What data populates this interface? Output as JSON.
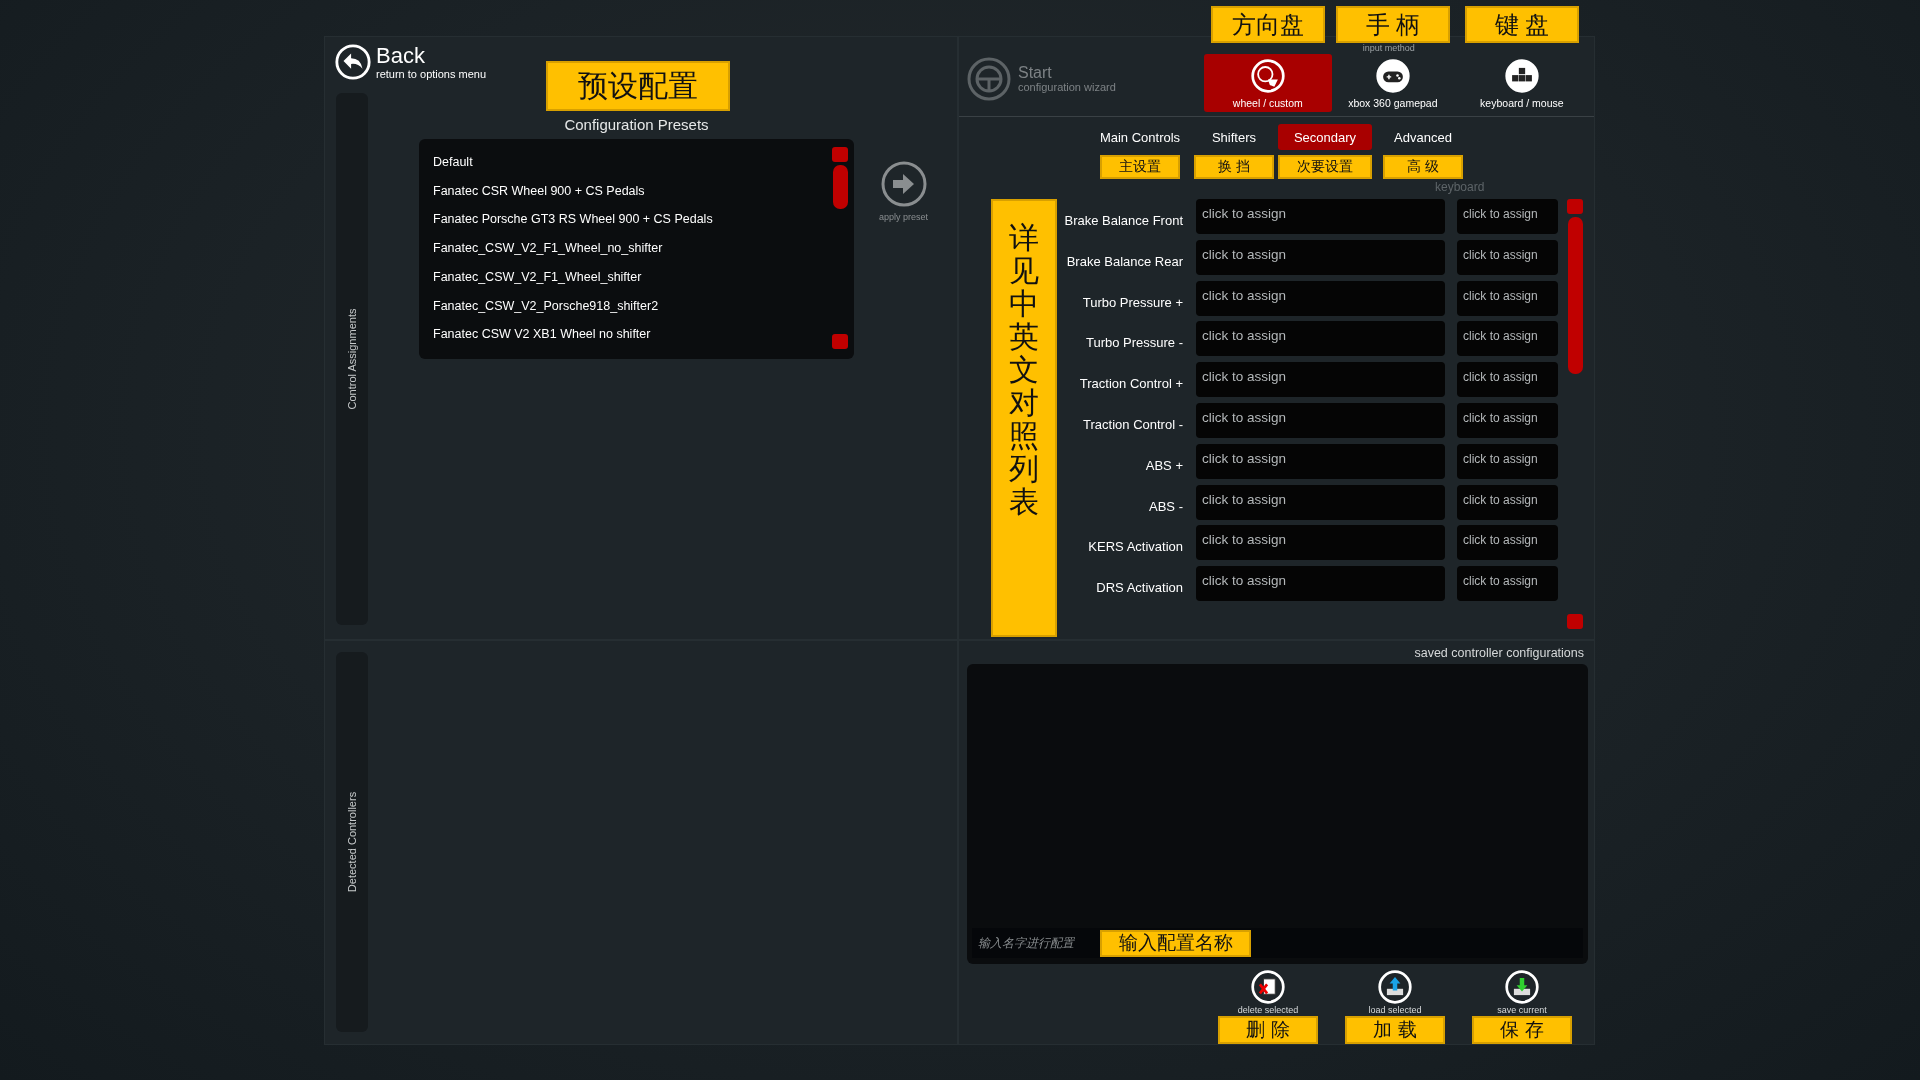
{
  "back": {
    "title": "Back",
    "subtitle": "return to options menu"
  },
  "sidebar_tabs": [
    {
      "label": "Control Assignments"
    },
    {
      "label": "Detected Controllers"
    }
  ],
  "presets": {
    "note": "预设配置",
    "title": "Configuration Presets",
    "apply_label": "apply preset",
    "items": [
      {
        "label": "Default"
      },
      {
        "label": "Fanatec CSR Wheel 900 + CS Pedals"
      },
      {
        "label": "Fanatec Porsche GT3 RS Wheel 900 + CS Pedals"
      },
      {
        "label": "Fanatec_CSW_V2_F1_Wheel_no_shifter"
      },
      {
        "label": "Fanatec_CSW_V2_F1_Wheel_shifter"
      },
      {
        "label": "Fanatec_CSW_V2_Porsche918_shifter2"
      },
      {
        "label": "Fanatec CSW V2 XB1 Wheel no shifter"
      }
    ]
  },
  "wizard": {
    "title": "Start",
    "subtitle": "configuration wizard"
  },
  "input_method": {
    "label": "input method",
    "options": [
      {
        "kind": "wheel",
        "label": "wheel / custom",
        "note": "方向盘",
        "selected": true
      },
      {
        "kind": "gamepad",
        "label": "xbox 360 gamepad",
        "note": "手 柄",
        "selected": false
      },
      {
        "kind": "keyboard",
        "label": "keyboard / mouse",
        "note": "键 盘",
        "selected": false
      }
    ]
  },
  "tabs": [
    {
      "label": "Main Controls",
      "note": "主设置",
      "selected": false
    },
    {
      "label": "Shifters",
      "note": "换 挡",
      "selected": false
    },
    {
      "label": "Secondary",
      "note": "次要设置",
      "selected": true
    },
    {
      "label": "Advanced",
      "note": "高 级",
      "selected": false
    }
  ],
  "assignments": {
    "note": "详见中英文对照列表",
    "column_2": "keyboard",
    "rows": [
      {
        "label": "Brake Balance Front",
        "primary": "click to assign",
        "secondary": "click to assign"
      },
      {
        "label": "Brake Balance Rear",
        "primary": "click to assign",
        "secondary": "click to assign"
      },
      {
        "label": "Turbo Pressure +",
        "primary": "click to assign",
        "secondary": "click to assign"
      },
      {
        "label": "Turbo Pressure -",
        "primary": "click to assign",
        "secondary": "click to assign"
      },
      {
        "label": "Traction Control +",
        "primary": "click to assign",
        "secondary": "click to assign"
      },
      {
        "label": "Traction Control -",
        "primary": "click to assign",
        "secondary": "click to assign"
      },
      {
        "label": "ABS +",
        "primary": "click to assign",
        "secondary": "click to assign"
      },
      {
        "label": "ABS -",
        "primary": "click to assign",
        "secondary": "click to assign"
      },
      {
        "label": "KERS Activation",
        "primary": "click to assign",
        "secondary": "click to assign"
      },
      {
        "label": "DRS Activation",
        "primary": "click to assign",
        "secondary": "click to assign"
      }
    ]
  },
  "saved": {
    "title": "saved controller configurations",
    "name_field": {
      "placeholder": "输入名字进行配置",
      "note": "输入配置名称"
    },
    "actions": [
      {
        "kind": "delete",
        "label": "delete selected",
        "note": "删 除"
      },
      {
        "kind": "load",
        "label": "load selected",
        "note": "加 载"
      },
      {
        "kind": "save",
        "label": "save current",
        "note": "保 存"
      }
    ]
  }
}
